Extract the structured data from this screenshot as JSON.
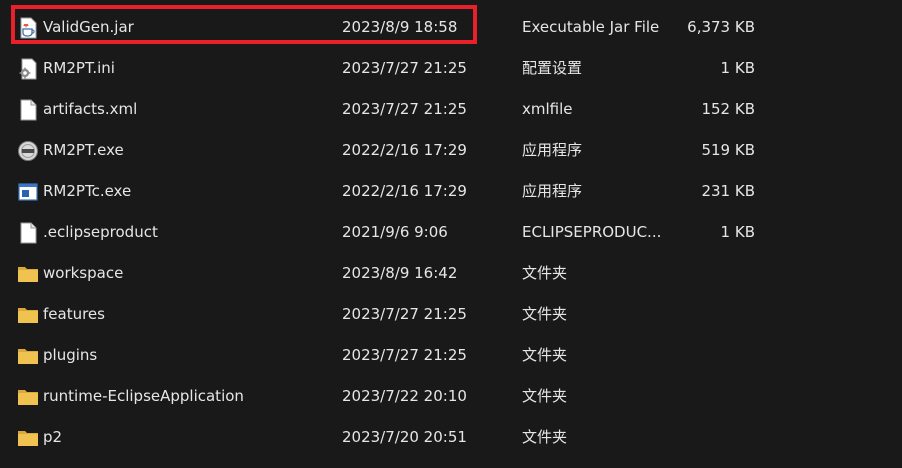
{
  "files": [
    {
      "name": "ValidGen.jar",
      "date": "2023/8/9 18:58",
      "type": "Executable Jar File",
      "size": "6,373 KB",
      "icon": "jar-file-icon"
    },
    {
      "name": "RM2PT.ini",
      "date": "2023/7/27 21:25",
      "type": "配置设置",
      "size": "1 KB",
      "icon": "settings-file-icon"
    },
    {
      "name": "artifacts.xml",
      "date": "2023/7/27 21:25",
      "type": "xmlfile",
      "size": "152 KB",
      "icon": "document-icon"
    },
    {
      "name": "RM2PT.exe",
      "date": "2022/2/16 17:29",
      "type": "应用程序",
      "size": "519 KB",
      "icon": "rm2pt-app-icon"
    },
    {
      "name": "RM2PTc.exe",
      "date": "2022/2/16 17:29",
      "type": "应用程序",
      "size": "231 KB",
      "icon": "console-app-icon"
    },
    {
      "name": ".eclipseproduct",
      "date": "2021/9/6 9:06",
      "type": "ECLIPSEPRODUC...",
      "size": "1 KB",
      "icon": "document-icon"
    },
    {
      "name": "workspace",
      "date": "2023/8/9 16:42",
      "type": "文件夹",
      "size": "",
      "icon": "folder-icon"
    },
    {
      "name": "features",
      "date": "2023/7/27 21:25",
      "type": "文件夹",
      "size": "",
      "icon": "folder-icon"
    },
    {
      "name": "plugins",
      "date": "2023/7/27 21:25",
      "type": "文件夹",
      "size": "",
      "icon": "folder-icon"
    },
    {
      "name": "runtime-EclipseApplication",
      "date": "2023/7/22 20:10",
      "type": "文件夹",
      "size": "",
      "icon": "folder-icon"
    },
    {
      "name": "p2",
      "date": "2023/7/20 20:51",
      "type": "文件夹",
      "size": "",
      "icon": "folder-icon"
    }
  ],
  "colors": {
    "background": "#191919",
    "text": "#e6e6e6",
    "highlight_border": "#e8202a",
    "folder": "#f0c24f"
  }
}
